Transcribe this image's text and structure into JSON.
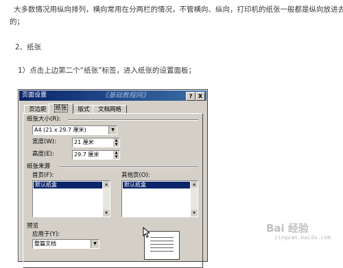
{
  "article": {
    "para1_line1": "大多数情况用纵向排列，横向常用在分两栏的情况，不管横向、纵向，打印机的纸张一般都是纵向放进去",
    "para1_line2": "的；",
    "section_heading": "2、纸张",
    "step1": "1）点击上边第二个“纸张”标签，进入纸张的设置面板；"
  },
  "dialog": {
    "title": "页面设置",
    "watermark": "《基础教程网》",
    "help_button": "?",
    "close_button": "X",
    "tabs": [
      {
        "label": "页边距",
        "active": false
      },
      {
        "label": "纸张",
        "active": true
      },
      {
        "label": "版式",
        "active": false
      },
      {
        "label": "文档网格",
        "active": false
      }
    ],
    "paper_size_label": "纸张大小(R):",
    "paper_size_value": "A4 (21 x 29.7 厘米)",
    "width_label": "宽度(W):",
    "width_value": "21 厘米",
    "height_label": "高度(E):",
    "height_value": "29.7 厘米",
    "paper_source_label": "纸张来源",
    "first_page_label": "首页(F):",
    "first_page_selected": "默认纸盒",
    "other_pages_label": "其他页(O):",
    "other_pages_selected": "默认纸盒",
    "preview_label": "预览",
    "apply_to_label": "应用于(Y):",
    "apply_to_value": "整篇文档"
  },
  "watermark": {
    "brand": "Bai 经验",
    "url": "jingyan.baidu.com"
  },
  "colors": {
    "titlebar": "#0a246a",
    "dialog_bg": "#d4d0c8",
    "selection": "#0a246a"
  }
}
